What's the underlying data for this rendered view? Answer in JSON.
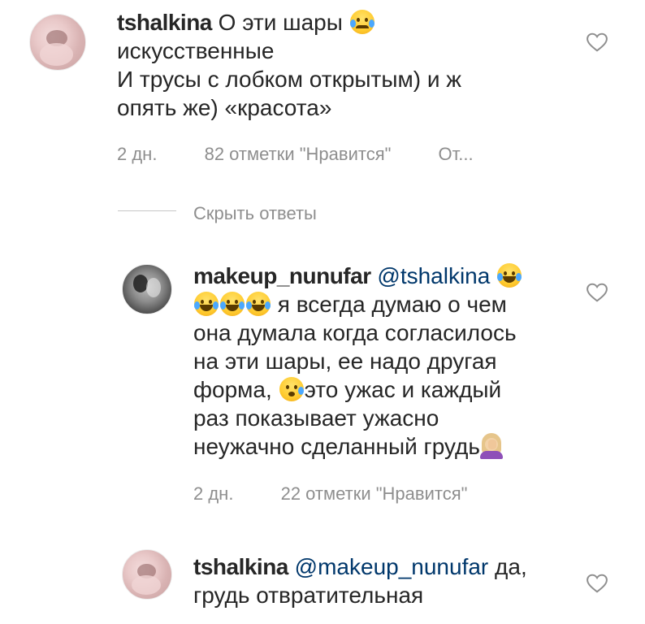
{
  "comments": [
    {
      "username": "tshalkina",
      "text_a": "О эти шары",
      "text_b": "искусственные",
      "text_c": "И трусы с лобком открытым) и ж",
      "text_d": "опять же) «красота»",
      "time": "2 дн.",
      "likes": "82 отметки \"Нравится\"",
      "reply": "От..."
    },
    {
      "username": "makeup_nunufar",
      "mention": "@tshalkina",
      "line2": "я всегда думаю о чем",
      "line3": "она думала когда согласилось",
      "line4": "на эти шары, ее надо другая",
      "line5a": "форма,",
      "line5b": "это ужас и каждый",
      "line6": "раз показывает ужасно",
      "line7": "неужачно сделанный грудь",
      "time": "2 дн.",
      "likes": "22 отметки \"Нравится\""
    },
    {
      "username": "tshalkina",
      "mention": "@makeup_nunufar",
      "text_a": "да,",
      "text_b": "грудь отвратительная"
    }
  ],
  "hide_replies_label": "Скрыть ответы",
  "icons": {
    "like": "heart-outline-icon",
    "crying": "crying-face-emoji",
    "laughing": "face-with-tears-of-joy-emoji",
    "sleepy": "sleepy-face-emoji",
    "facepalm": "woman-facepalming-emoji"
  },
  "colors": {
    "text": "#262626",
    "muted": "#8e8e8e",
    "mention": "#00376b"
  }
}
